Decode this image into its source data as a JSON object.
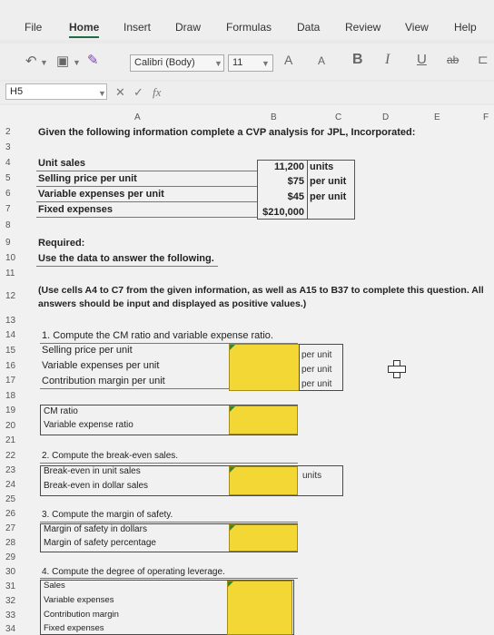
{
  "menu": [
    "File",
    "Home",
    "Insert",
    "Draw",
    "Formulas",
    "Data",
    "Review",
    "View",
    "Help"
  ],
  "toolbar": {
    "font_name": "Calibri (Body)",
    "font_size": "11",
    "grow_font": "A",
    "shrink_font": "A",
    "bold": "B",
    "italic": "I",
    "underline": "U",
    "strikethrough": "ab"
  },
  "formula_bar": {
    "name_box": "H5",
    "cancel": "✕",
    "enter": "✓",
    "fx": "fx"
  },
  "columns": [
    "A",
    "B",
    "C",
    "D",
    "E",
    "F"
  ],
  "rows": [
    "2",
    "3",
    "4",
    "5",
    "6",
    "7",
    "8",
    "9",
    "10",
    "11",
    "12",
    "13",
    "14",
    "15",
    "16",
    "17",
    "18",
    "19",
    "20",
    "21",
    "22",
    "23",
    "24",
    "25",
    "26",
    "27",
    "28",
    "29",
    "30",
    "31",
    "32",
    "33",
    "34"
  ],
  "sheet": {
    "title": "Given the following information complete a CVP analysis for JPL, Incorporated:",
    "given": [
      {
        "label": "Unit sales",
        "value": "11,200",
        "unit": "units"
      },
      {
        "label": "Selling price per unit",
        "value": "$75",
        "unit": "per unit"
      },
      {
        "label": "Variable expenses per unit",
        "value": "$45",
        "unit": "per unit"
      },
      {
        "label": "Fixed expenses",
        "value": "$210,000",
        "unit": ""
      }
    ],
    "required": "Required:",
    "instruction": "Use the data to answer the following.",
    "note_line1": "(Use cells A4 to C7 from the given information, as well as A15 to B37 to complete this question. All",
    "note_line2": "answers should be input and displayed as positive values.)",
    "q1_title": "1. Compute the CM ratio and variable expense ratio.",
    "q1_rows": [
      "Selling price per unit",
      "Variable expenses per unit",
      "Contribution margin per unit"
    ],
    "q1_units": [
      "per unit",
      "per unit",
      "per unit"
    ],
    "q1_ratios": [
      "CM ratio",
      "Variable expense ratio"
    ],
    "q2_title": "2. Compute the break-even sales.",
    "q2_rows": [
      "Break-even in unit sales",
      "Break-even in dollar sales"
    ],
    "q2_unit": "units",
    "q3_title": "3. Compute the margin of safety.",
    "q3_rows": [
      "Margin of safety in dollars",
      "Margin of safety percentage"
    ],
    "q4_title": "4. Compute the degree of operating leverage.",
    "q4_rows": [
      "Sales",
      "Variable expenses",
      "Contribution margin",
      "Fixed expenses"
    ]
  }
}
